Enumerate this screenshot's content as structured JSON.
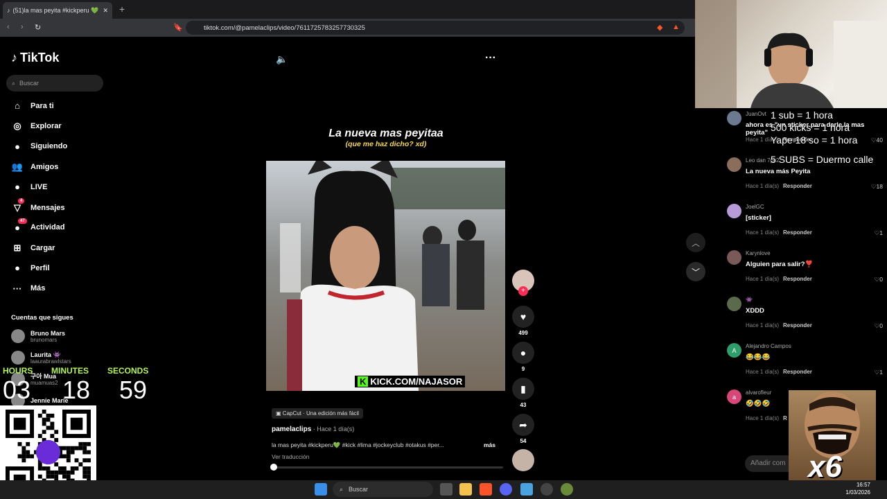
{
  "browser": {
    "tab_title": "(51)la mas peyita #kickperu 💚",
    "url": "tiktok.com/@pamelaclips/video/7611725783257730325"
  },
  "tiktok": {
    "logo": "TikTok",
    "search_placeholder": "Buscar",
    "nav": [
      {
        "label": "Para ti",
        "icon": "home-icon",
        "glyph": "⌂"
      },
      {
        "label": "Explorar",
        "icon": "compass-icon",
        "glyph": "◎"
      },
      {
        "label": "Siguiendo",
        "icon": "following-avatar-icon",
        "glyph": "●"
      },
      {
        "label": "Amigos",
        "icon": "friends-icon",
        "glyph": "👥"
      },
      {
        "label": "LIVE",
        "icon": "live-icon",
        "glyph": "●"
      },
      {
        "label": "Mensajes",
        "icon": "messages-icon",
        "glyph": "▽",
        "badge": "4"
      },
      {
        "label": "Actividad",
        "icon": "activity-icon",
        "glyph": "●",
        "badge": "47"
      },
      {
        "label": "Cargar",
        "icon": "upload-icon",
        "glyph": "⊞"
      },
      {
        "label": "Perfil",
        "icon": "profile-icon",
        "glyph": "●"
      },
      {
        "label": "Más",
        "icon": "more-dots-icon",
        "glyph": "···"
      }
    ],
    "following_heading": "Cuentas que sigues",
    "following": [
      {
        "name": "Bruno Mars",
        "handle": "brunomars"
      },
      {
        "name": "Laurita 👾",
        "handle": "laaurabrawlstars"
      },
      {
        "name": "구아 Mua",
        "handle": "muamuas2"
      },
      {
        "name": "Jennie Marie",
        "handle": ""
      }
    ]
  },
  "timer": {
    "hours_label": "HOURS",
    "minutes_label": "MINUTES",
    "seconds_label": "SECONDS",
    "hours": "03",
    "minutes": "18",
    "seconds": "59"
  },
  "video": {
    "caption_line1": "La nueva mas peyitaa",
    "caption_line2": "(que me haz dicho? xd)",
    "watermark": "KICK.COM/NAJASOR",
    "watermark_k": "K",
    "capcut": "CapCut · Una edición más fácil",
    "author": "pamelaclips",
    "posted": " · Hace 1 día(s)",
    "description": "la mas peyita #kickperu💚 #kick #lima #jockeyclub #otakus #per...",
    "more": "más",
    "translate": "Ver traducción",
    "progress": 0.01,
    "actions": {
      "likes": "499",
      "comments": "9",
      "saves": "43",
      "shares": "54"
    }
  },
  "comments": [
    {
      "user": "JuanOvt",
      "text": "ahora es \"un sticker para darle la mas peyita\"",
      "time": "Hace 1 día(s)",
      "reply": "Responder",
      "likes": "40"
    },
    {
      "user": "Leo dan 7pk2",
      "text": "La nueva más Peyita",
      "time": "Hace 1 día(s)",
      "reply": "Responder",
      "likes": "18"
    },
    {
      "user": "JoelGC",
      "text": "[sticker]",
      "time": "Hace 1 día(s)",
      "reply": "Responder",
      "likes": "1"
    },
    {
      "user": "Karynlove",
      "text": "Alguien para salir?❣️",
      "time": "Hace 1 día(s)",
      "reply": "Responder",
      "likes": "0"
    },
    {
      "user": "👾",
      "text": "XDDD",
      "time": "Hace 1 día(s)",
      "reply": "Responder",
      "likes": "0"
    },
    {
      "user": "Alejandro Campos",
      "text": "😂😂😂",
      "time": "Hace 1 día(s)",
      "reply": "Responder",
      "likes": "1",
      "initial": "A"
    },
    {
      "user": "alvarofleur",
      "text": "🤣🤣🤣",
      "time": "Hace 1 día(s)",
      "reply": "R",
      "likes": "",
      "initial": "a"
    }
  ],
  "add_comment": "Añadir com",
  "overlay": [
    "1 sub = 1 hora",
    "500 kicks = 1 hora",
    "Yape 18 so = 1 hora",
    "5 SUBS = Duermo calle"
  ],
  "meme_text": "x6",
  "taskbar": {
    "search": "Buscar",
    "time": "16:57",
    "date": "1/03/2026"
  },
  "colors": {
    "accent": "#fe2c55",
    "timer": "#b4f35a",
    "kick": "#53fc18"
  }
}
